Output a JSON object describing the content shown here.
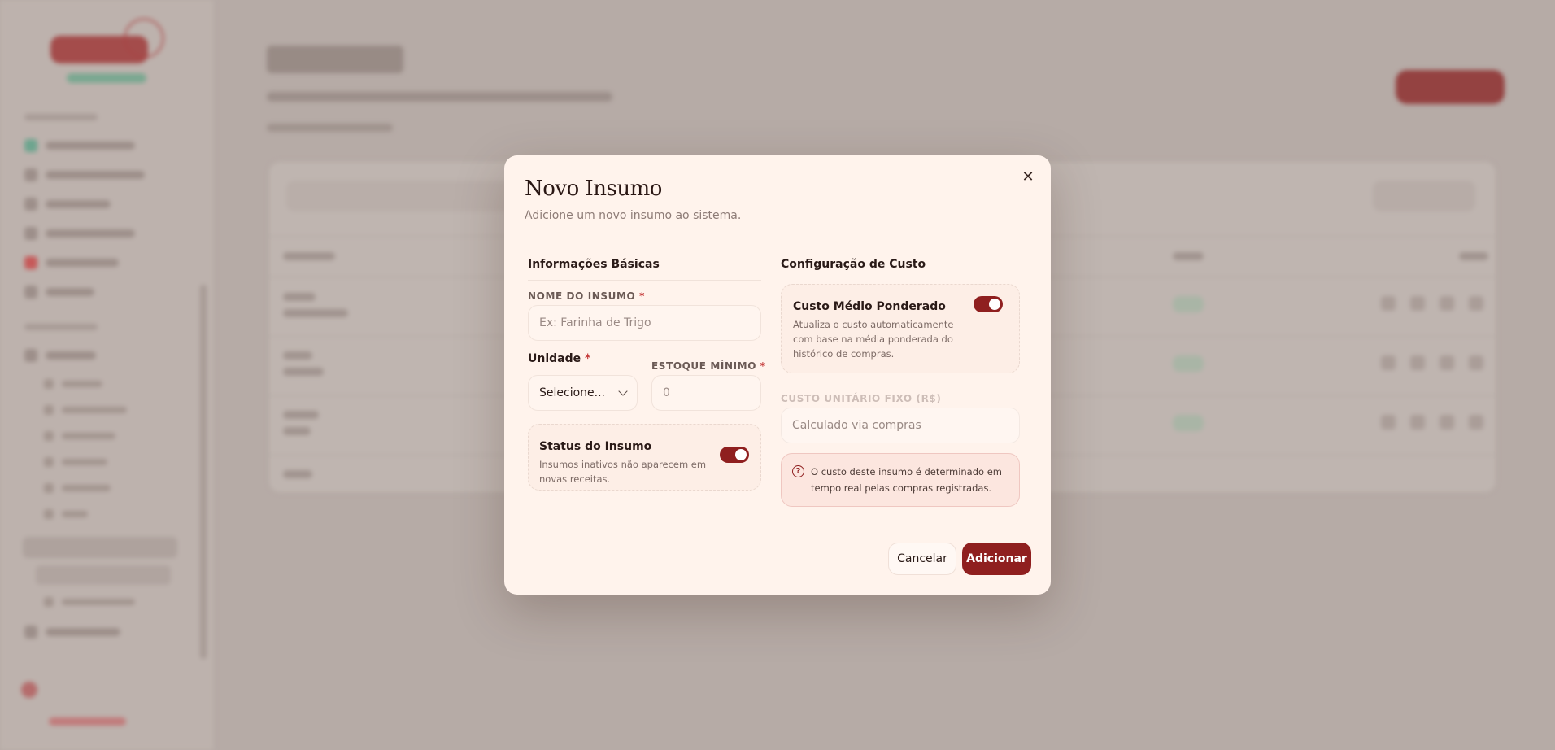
{
  "modal": {
    "title": "Novo Insumo",
    "description": "Adicione um novo insumo ao sistema.",
    "close_icon": "close-icon",
    "basic_info": {
      "section_title": "Informações Básicas",
      "name_label": "NOME DO INSUMO",
      "name_placeholder": "Ex: Farinha de Trigo",
      "unit_label": "Unidade",
      "unit_value": "Selecione...",
      "min_stock_label": "ESTOQUE MÍNIMO",
      "min_stock_placeholder": "0",
      "required_mark": "*",
      "status": {
        "title": "Status do Insumo",
        "text": "Insumos inativos não aparecem em novas receitas.",
        "enabled": true
      }
    },
    "cost_config": {
      "section_title": "Configuração de Custo",
      "weighted": {
        "title": "Custo Médio Ponderado",
        "text": "Atualiza o custo automaticamente com base na média ponderada do histórico de compras.",
        "enabled": true
      },
      "fixed_cost_label": "CUSTO UNITÁRIO FIXO (R$)",
      "fixed_cost_placeholder": "Calculado via compras",
      "info_text": "O custo deste insumo é determinado em tempo real pelas compras registradas."
    },
    "buttons": {
      "cancel": "Cancelar",
      "submit": "Adicionar"
    }
  },
  "colors": {
    "accent": "#8f1f1f",
    "modal_bg": "#fff3ec",
    "overlay": "#b6aba6"
  }
}
